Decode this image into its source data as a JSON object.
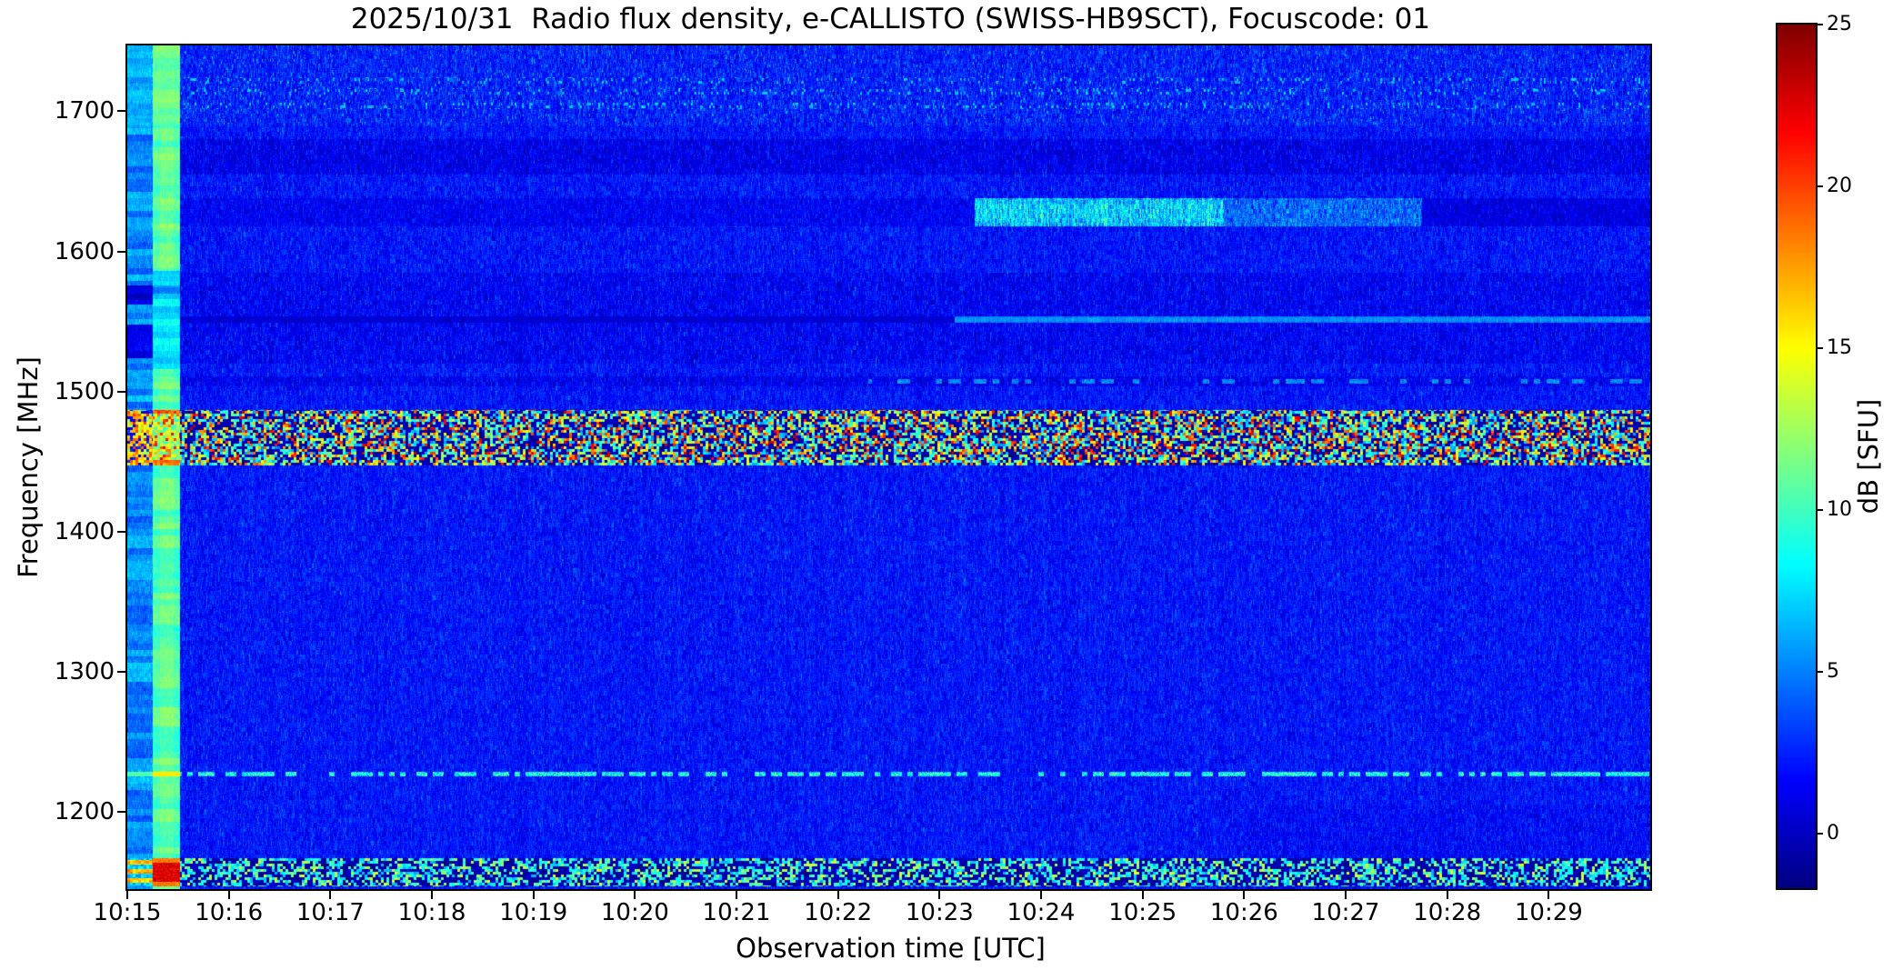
{
  "chart_data": {
    "type": "heatmap",
    "title": "2025/10/31  Radio flux density, e-CALLISTO (SWISS-HB9SCT), Focuscode: 01",
    "date": "2025/10/31",
    "instrument": "e-CALLISTO",
    "station": "SWISS-HB9SCT",
    "focuscode": "01",
    "xlabel": "Observation time [UTC]",
    "ylabel": "Frequency [MHz]",
    "colorbar_label": "dB [SFU]",
    "colormap": "jet",
    "grid": false,
    "x_ticks": [
      "10:15",
      "10:16",
      "10:17",
      "10:18",
      "10:19",
      "10:20",
      "10:21",
      "10:22",
      "10:23",
      "10:24",
      "10:25",
      "10:26",
      "10:27",
      "10:28",
      "10:29"
    ],
    "x_tick_interval_minutes": 1,
    "y_ticks": [
      "1700",
      "1600",
      "1500",
      "1400",
      "1300",
      "1200"
    ],
    "colorbar_ticks": [
      "25",
      "20",
      "15",
      "10",
      "5",
      "0"
    ],
    "x_range_minutes": [
      0,
      15
    ],
    "freq_range_mhz": [
      1145,
      1747
    ],
    "value_range_db": [
      -1.7,
      25
    ],
    "background_level_db": 2.1,
    "features": [
      {
        "id": "startup-scan-column",
        "type": "bright-column",
        "t_min": [
          0.0,
          0.25
        ],
        "level_db": 5.3,
        "description": "light-blue vertical stripe at start of recording"
      },
      {
        "id": "calibration-column",
        "type": "bright-column",
        "t_min": [
          0.25,
          0.52
        ],
        "level_db": 10.4,
        "description": "bright cyan-green calibration stripe"
      },
      {
        "id": "calibration-hot-spot",
        "type": "hot-blob",
        "t_min": [
          0.25,
          0.52
        ],
        "freq_mhz": [
          1147,
          1167
        ],
        "level_db": 22.4,
        "description": "red saturated blob at bottom of calibration stripe"
      },
      {
        "id": "rfi-speckle-band-1450-1487",
        "type": "speckle-band",
        "freq_mhz": [
          1447,
          1487
        ],
        "levels_db": [
          -1.7,
          23.5
        ],
        "description": "dense multicolour RFI speckle band across full duration"
      },
      {
        "id": "gps-l2-line-1227",
        "type": "dashed-line",
        "freq_mhz": [
          1225.5,
          1228.5
        ],
        "level_db": 8.7,
        "description": "intermittent cyan GPS L2 carrier line"
      },
      {
        "id": "bottom-rfi-band-1150",
        "type": "speckle-band",
        "freq_mhz": [
          1147,
          1167
        ],
        "levels_db": [
          -1.7,
          14.5
        ],
        "description": "cyan/navy speckle band near bottom edge"
      },
      {
        "id": "iridium-band-1620",
        "type": "transient-band",
        "freq_mhz": [
          1618,
          1638
        ],
        "bright_t_min": [
          8.35,
          10.8
        ],
        "fade_t_min": [
          10.8,
          12.75
        ],
        "level_db": 6.2,
        "fade_level_db": 4.4,
        "dark_level_db": 0.9,
        "pre_level_db": 1.45,
        "description": "light-blue emission band appearing after ~10:23"
      },
      {
        "id": "step-line-1551",
        "type": "step-line",
        "freq_mhz": [
          1549,
          1554
        ],
        "switch_t_min": 8.15,
        "dark_level_db": 0.45,
        "bright_level_db": 4.7,
        "description": "dark channel switching to bright carrier at ~10:23"
      },
      {
        "id": "dark-band-1655-1680",
        "type": "dark-band",
        "freq_mhz": [
          1655,
          1680
        ],
        "delta_db": -0.9
      },
      {
        "id": "dark-band-1520-1585",
        "type": "dark-band",
        "freq_mhz": [
          1520,
          1585
        ],
        "delta_db": -0.55
      },
      {
        "id": "dark-line-1507",
        "type": "dark-band",
        "freq_mhz": [
          1504,
          1511
        ],
        "delta_db": -0.8
      },
      {
        "id": "late-dashed-line-1507",
        "type": "dashed-line",
        "freq_mhz": [
          1506,
          1509
        ],
        "t_min": [
          7.3,
          15
        ],
        "level_db": 5.5
      },
      {
        "id": "top-speckle-zone",
        "type": "speckle-zone",
        "freq_mhz": [
          1690,
          1747
        ],
        "speckle_lines_mhz": [
          1704,
          1714,
          1722
        ],
        "level_db": 7
      },
      {
        "id": "bottom-right-dark",
        "type": "dark-band",
        "freq_mhz": [
          1145,
          1205
        ],
        "t_min": [
          11,
          15
        ],
        "delta_db": -0.35
      }
    ]
  }
}
